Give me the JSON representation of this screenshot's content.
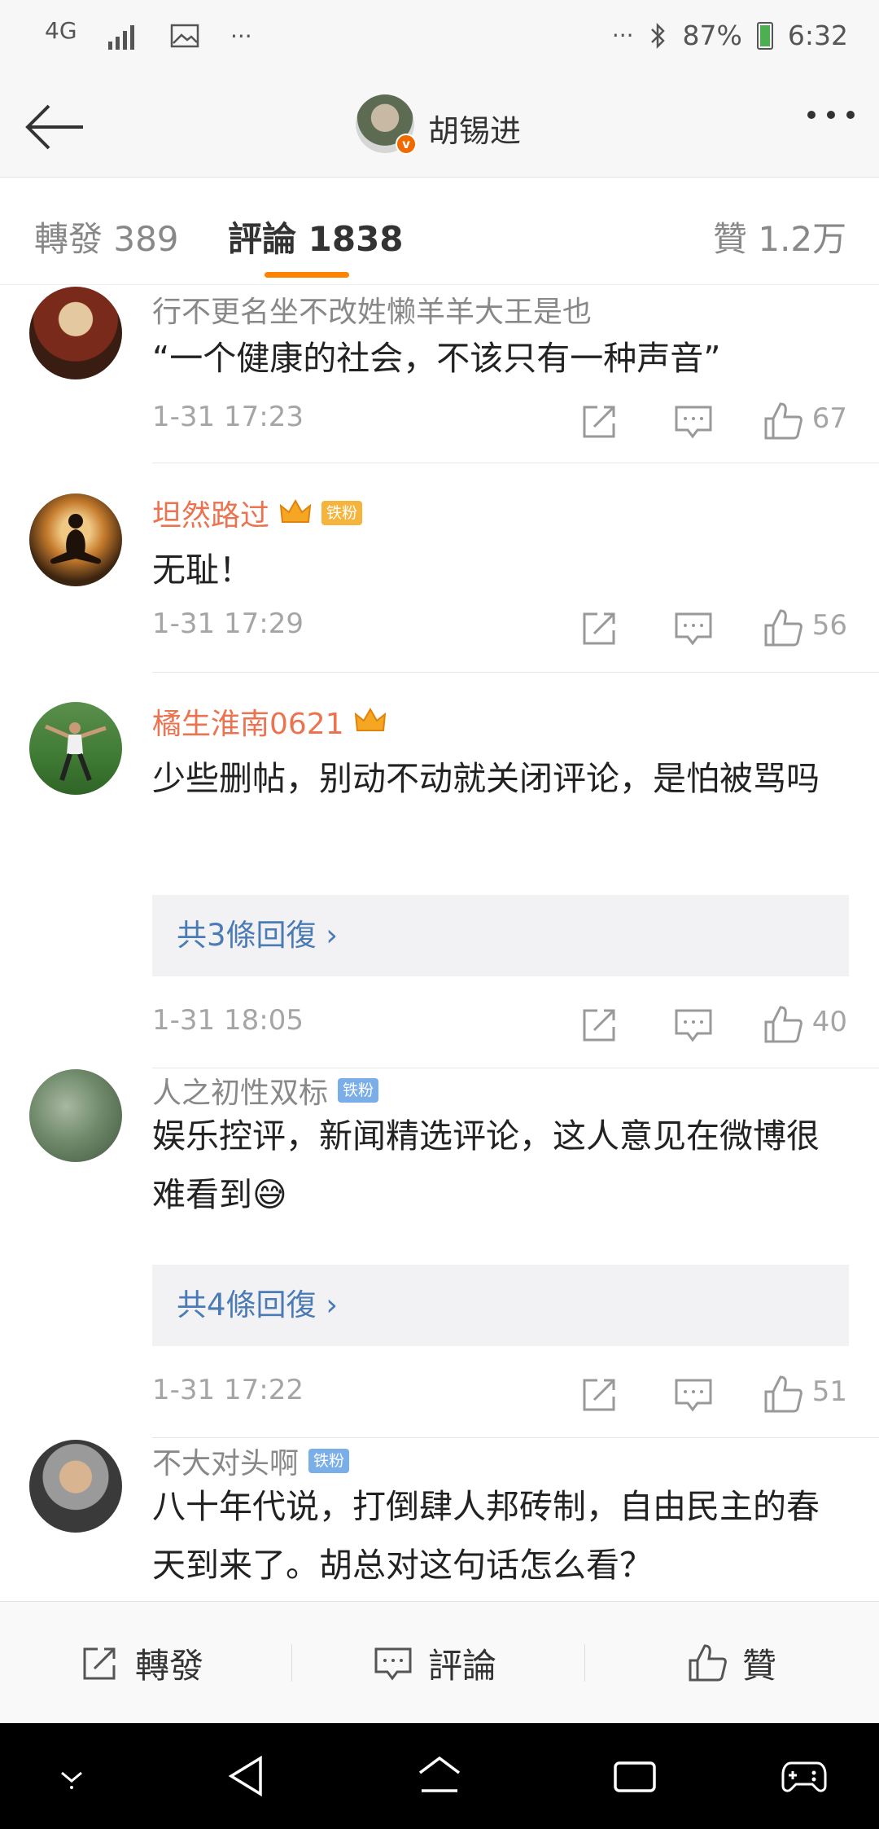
{
  "status_bar": {
    "network": "4G",
    "more_left": "···",
    "more_right": "···",
    "battery": "87%",
    "time": "6:32"
  },
  "header": {
    "user_name": "胡锡进",
    "verified": "v"
  },
  "tabs": [
    {
      "label": "轉發 389"
    },
    {
      "label": "評論 1838"
    },
    {
      "label": "贊 1.2万"
    }
  ],
  "comments": [
    {
      "user": "行不更名坐不改姓懒羊羊大王是也",
      "badge": "",
      "text": "“一个健康的社会，不该只有一种声音”",
      "time": "1-31 17:23",
      "likes": "67"
    },
    {
      "user": "坦然路过",
      "badge": "铁粉",
      "text": "无耻！",
      "time": "1-31 17:29",
      "likes": "56"
    },
    {
      "user": "橘生淮南0621",
      "badge": "",
      "text": "少些删帖，别动不动就关闭评论，是怕被骂吗",
      "replies": "共3條回復 ›",
      "time": "1-31 18:05",
      "likes": "40"
    },
    {
      "user": "人之初性双标",
      "badge": "铁粉",
      "text": "娱乐控评，新闻精选评论，这人意见在微博很难看到",
      "emoji": "😅",
      "replies": "共4條回復 ›",
      "time": "1-31 17:22",
      "likes": "51"
    },
    {
      "user": "不大对头啊",
      "badge": "铁粉",
      "text": "八十年代说，打倒肆人邦砖制，自由民主的春天到来了。胡总对这句话怎么看？"
    }
  ],
  "bottom_bar": {
    "repost": "轉發",
    "comment": "評論",
    "like": "贊"
  },
  "colors": {
    "accent": "#ff8200",
    "link": "#4a7bb5",
    "username_vip": "#eb7350",
    "iron_fan_badge": "#7aaee8"
  }
}
